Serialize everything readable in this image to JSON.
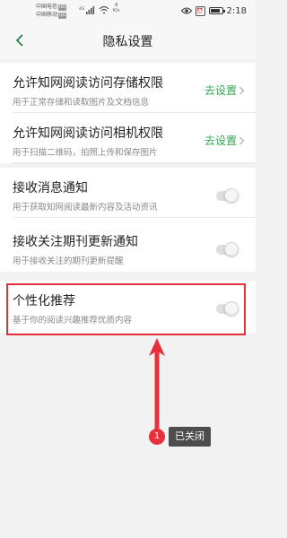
{
  "status_bar": {
    "carrier1": "中国电信",
    "carrier2": "中国移动",
    "hd_badge": "HD",
    "network": "4G",
    "speed_value": "8",
    "speed_unit": "K/s",
    "time": "2:18",
    "battery_level": 0.85
  },
  "header": {
    "title": "隐私设置"
  },
  "settings": [
    {
      "title": "允许知网阅读访问存储权限",
      "subtitle": "用于正常存储和读取图片及文档信息",
      "action": "去设置"
    },
    {
      "title": "允许知网阅读访问相机权限",
      "subtitle": "用于扫描二维码，拍照上传和保存图片",
      "action": "去设置"
    },
    {
      "title": "接收消息通知",
      "subtitle": "用于获取知网阅读最新内容及活动资讯",
      "enabled": false
    },
    {
      "title": "接收关注期刊更新通知",
      "subtitle": "用于接收关注的期刊更新提醒",
      "enabled": false
    },
    {
      "title": "个性化推荐",
      "subtitle": "基于你的阅读兴趣推荐优质内容",
      "enabled": false
    }
  ],
  "annotation": {
    "step": "1",
    "text": "已关闭"
  },
  "colors": {
    "accent": "#34a853",
    "highlight": "#e8303c"
  }
}
